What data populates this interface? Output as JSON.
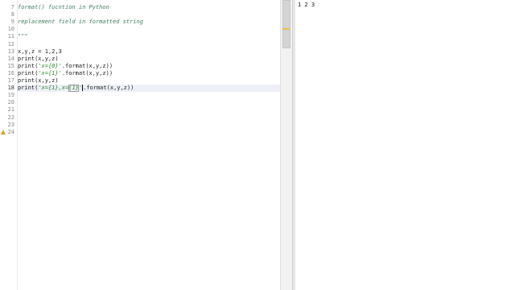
{
  "editor": {
    "lines": [
      {
        "num": "7",
        "segments": [
          {
            "text": "format() fucntion in Python",
            "cls": "comment"
          }
        ]
      },
      {
        "num": "8",
        "segments": []
      },
      {
        "num": "9",
        "segments": [
          {
            "text": "replacement field in formatted string",
            "cls": "comment"
          }
        ]
      },
      {
        "num": "10",
        "segments": []
      },
      {
        "num": "11",
        "segments": [
          {
            "text": "\"\"\"",
            "cls": "comment"
          }
        ]
      },
      {
        "num": "12",
        "segments": []
      },
      {
        "num": "13",
        "segments": [
          {
            "text": "x,y,z = 1,2,3",
            "cls": "plain"
          }
        ]
      },
      {
        "num": "14",
        "segments": [
          {
            "text": "print(x,y,z)",
            "cls": "plain"
          }
        ]
      },
      {
        "num": "15",
        "segments": [
          {
            "text": "print(",
            "cls": "plain"
          },
          {
            "text": "'x={0}'",
            "cls": "str"
          },
          {
            "text": ".format(x,y,z))",
            "cls": "plain"
          }
        ]
      },
      {
        "num": "16",
        "segments": [
          {
            "text": "print(",
            "cls": "plain"
          },
          {
            "text": "'x={1}'",
            "cls": "str"
          },
          {
            "text": ".format(x,y,z))",
            "cls": "plain"
          }
        ]
      },
      {
        "num": "17",
        "segments": [
          {
            "text": "print(x,y,z)",
            "cls": "plain"
          }
        ]
      },
      {
        "num": "18",
        "current": true,
        "segments": [
          {
            "text": "print(",
            "cls": "plain"
          },
          {
            "text": "'x={1},x=",
            "cls": "str"
          },
          {
            "text": "{1}",
            "cls": "str box"
          },
          {
            "text": "'",
            "cls": "str caret-after"
          },
          {
            "text": ".format(x,y,z))",
            "cls": "plain"
          }
        ]
      },
      {
        "num": "19",
        "segments": []
      },
      {
        "num": "20",
        "segments": []
      },
      {
        "num": "21",
        "segments": []
      },
      {
        "num": "22",
        "segments": []
      },
      {
        "num": "23",
        "segments": []
      },
      {
        "num": "24",
        "warning": true,
        "segments": []
      }
    ]
  },
  "console": {
    "output": "1 2 3"
  },
  "icons": {
    "warning": "warning-icon"
  }
}
